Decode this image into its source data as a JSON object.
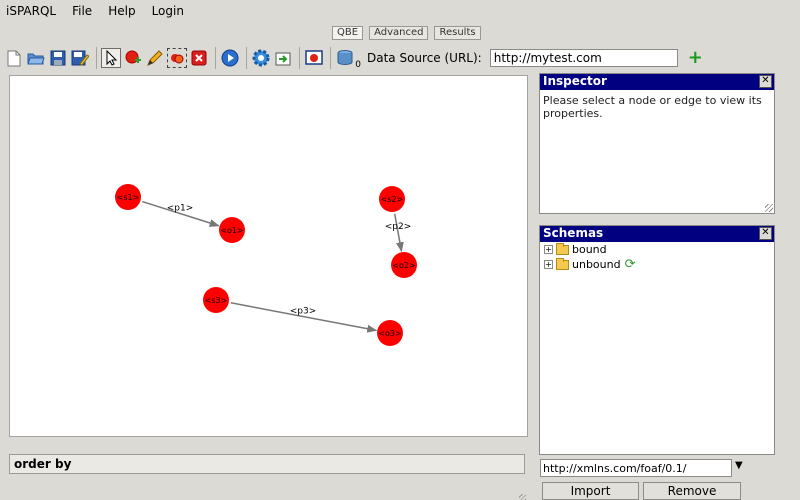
{
  "menubar": {
    "app_name": "iSPARQL",
    "items": [
      "File",
      "Help",
      "Login"
    ]
  },
  "view_tabs": [
    {
      "label": "QBE",
      "active": true
    },
    {
      "label": "Advanced",
      "active": false
    },
    {
      "label": "Results",
      "active": false
    }
  ],
  "toolbar": {
    "icons": [
      "new-document-icon",
      "open-folder-icon",
      "save-icon",
      "save-as-icon",
      "select-arrow-icon",
      "add-node-icon",
      "pencil-icon",
      "group-nodes-icon",
      "delete-icon",
      "run-query-icon",
      "settings-gear-icon",
      "export-icon",
      "visualize-icon",
      "database-icon"
    ],
    "database_count": "0",
    "datasource_label": "Data Source (URL):",
    "datasource_value": "http://mytest.com",
    "add_symbol": "+"
  },
  "graph": {
    "nodes": [
      {
        "id": "s1",
        "label": "<s1>"
      },
      {
        "id": "o1",
        "label": "<o1>"
      },
      {
        "id": "s2",
        "label": "<s2>"
      },
      {
        "id": "o2",
        "label": "<o2>"
      },
      {
        "id": "s3",
        "label": "<s3>"
      },
      {
        "id": "o3",
        "label": "<o3>"
      }
    ],
    "edges": [
      {
        "from": "s1",
        "to": "o1",
        "label": "<p1>"
      },
      {
        "from": "s2",
        "to": "o2",
        "label": "<p2>"
      },
      {
        "from": "s3",
        "to": "o3",
        "label": "<p3>"
      }
    ],
    "node_color": "#ff0000",
    "edge_color": "#777777"
  },
  "order_by_label": "order by",
  "inspector": {
    "title": "Inspector",
    "close_symbol": "✕",
    "message": "Please select a node or edge to view its properties."
  },
  "schemas": {
    "title": "Schemas",
    "close_symbol": "✕",
    "tree": [
      {
        "label": "bound",
        "expander": "+"
      },
      {
        "label": "unbound",
        "expander": "+"
      }
    ],
    "refresh_symbol": "⟳",
    "url_value": "http://xmlns.com/foaf/0.1/",
    "dropdown_symbol": "▼",
    "import_label": "Import",
    "remove_label": "Remove"
  }
}
